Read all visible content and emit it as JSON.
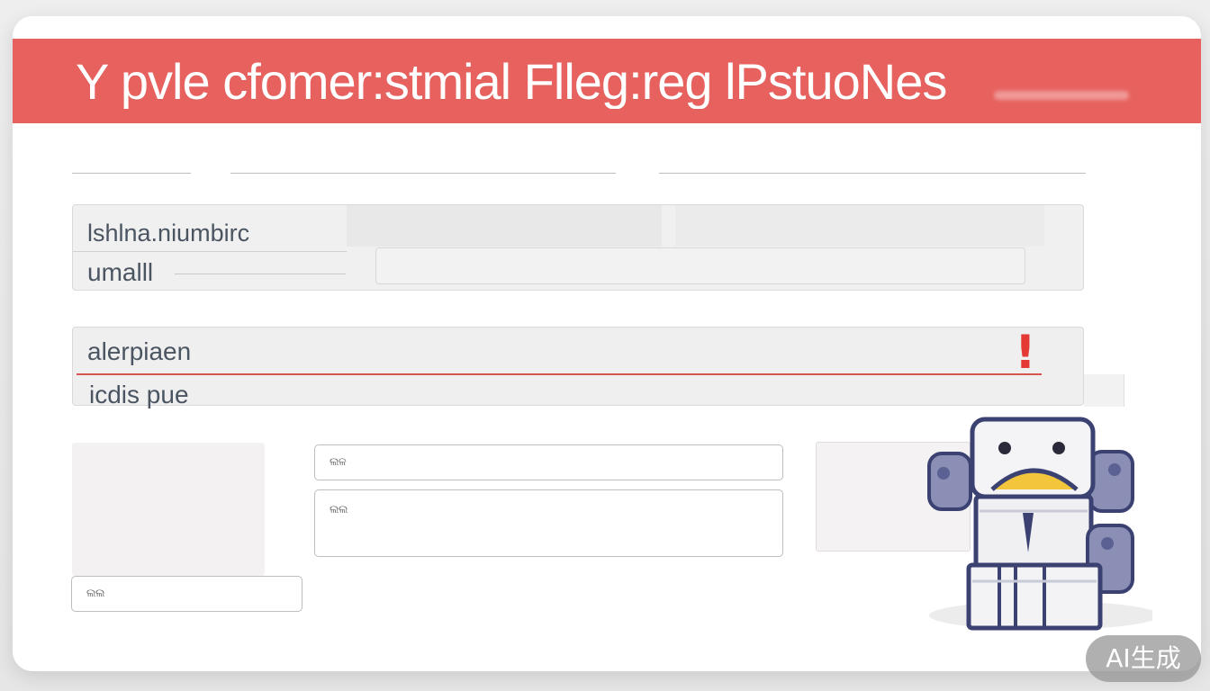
{
  "header": {
    "title": "Y pvle cfomer:stmial Flleg:reg lPstuoNes",
    "background_color": "#e7625f"
  },
  "contact_panel": {
    "field_label_1": "lshlna.niumbirc",
    "field_label_2": "umalll"
  },
  "alert_panel": {
    "field_label_1": "alerpiaen",
    "field_label_2": "icdis pue",
    "alert_icon": "!",
    "alert_color": "#e53935"
  },
  "form": {
    "field_1_label": "ଲଳ",
    "field_2_label": "ଲଲ",
    "field_3_label": "ଲଲ"
  },
  "mascot": {
    "icon": "robot-icon"
  },
  "badge": {
    "label": "AI生成"
  }
}
